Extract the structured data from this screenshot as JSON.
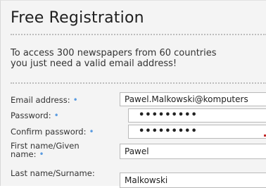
{
  "title": "Free Registration",
  "intro": {
    "line1": "To access 300 newspapers from 60 countries",
    "line2": "you just need a valid email address!"
  },
  "form": {
    "required_mark": "•",
    "email": {
      "label": "Email address:",
      "value": "Pawel.Malkowski@komputers"
    },
    "password": {
      "label": "Password:",
      "value": "•••••••••"
    },
    "confirm_password": {
      "label": "Confirm password:",
      "value": "•••••••••"
    },
    "first_name": {
      "label_line1": "First name/Given",
      "label_line2": "name:",
      "value": "Pawel"
    },
    "last_name": {
      "label": "Last name/Surname:",
      "value": "Malkowski"
    }
  },
  "colors": {
    "required": "#5a9be0",
    "marker": "#c42b2b"
  }
}
